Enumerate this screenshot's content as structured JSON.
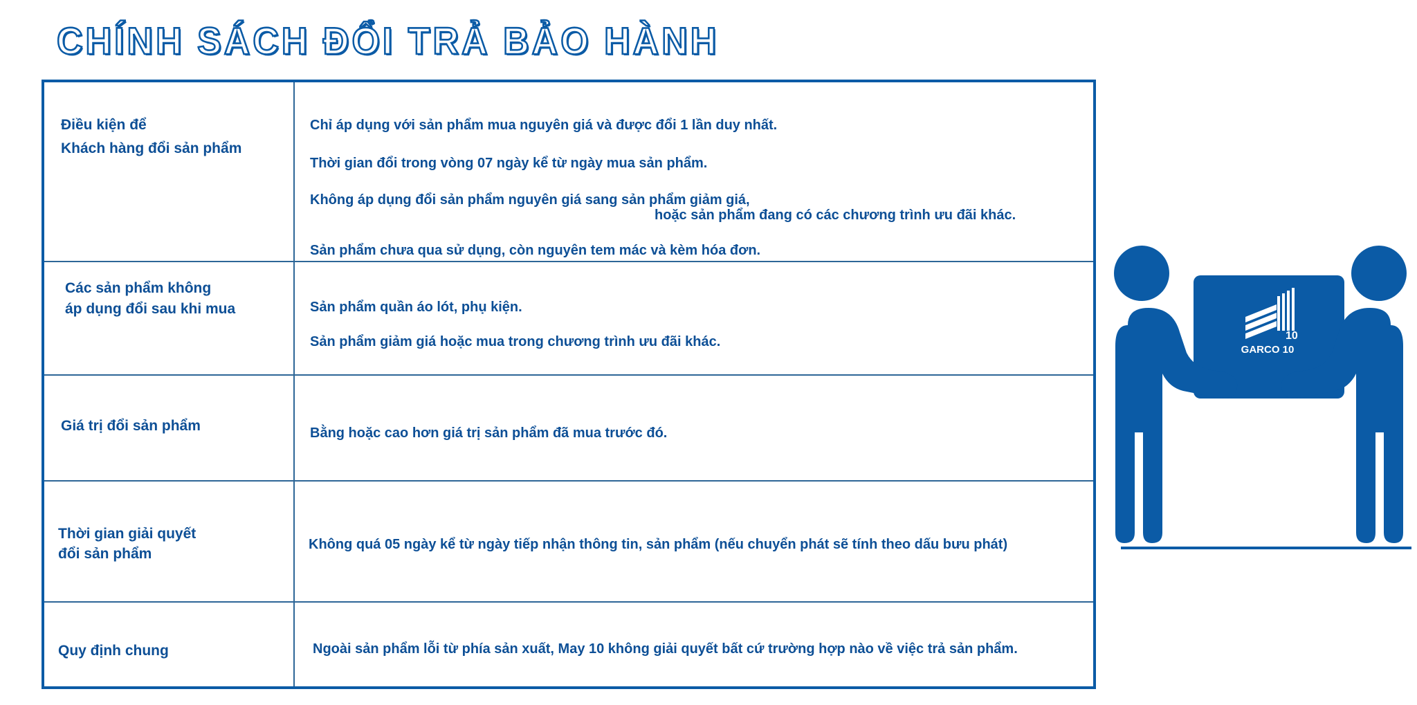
{
  "title": "CHÍNH SÁCH ĐỔI TRẢ BẢO HÀNH",
  "rows": [
    {
      "label": [
        "Điều kiện để",
        "Khách hàng đổi sản phẩm"
      ],
      "content": [
        "Chỉ áp dụng với sản phẩm mua nguyên giá và được đổi 1 lần duy nhất.",
        "Thời gian đổi trong vòng 07 ngày kể từ ngày mua sản phẩm.",
        "Không áp dụng đổi sản phẩm nguyên giá sang sản phẩm giảm giá,",
        "hoặc sản phẩm đang có các chương trình ưu đãi khác.",
        "Sản phẩm chưa qua sử dụng, còn nguyên tem mác và kèm hóa đơn."
      ]
    },
    {
      "label": [
        "Các sản phẩm không",
        "áp dụng đổi sau khi mua"
      ],
      "content": [
        "Sản phẩm quần áo lót, phụ kiện.",
        "Sản phẩm giảm giá hoặc mua trong chương trình ưu đãi khác."
      ]
    },
    {
      "label": [
        "Giá trị đổi sản phẩm"
      ],
      "content": [
        "Bằng hoặc cao hơn giá trị sản phẩm đã mua trước đó."
      ]
    },
    {
      "label": [
        "Thời gian giải quyết",
        "đổi sản phẩm"
      ],
      "content": [
        "Không quá 05 ngày kể từ ngày tiếp nhận thông tin, sản phẩm (nếu chuyển phát sẽ tính theo dấu bưu phát)"
      ]
    },
    {
      "label": [
        "Quy định chung"
      ],
      "content": [
        "Ngoài sản phẩm lỗi từ phía sản xuất, May 10 không giải quyết bất cứ trường hợp nào về việc trả sản phẩm."
      ]
    }
  ],
  "illustration": {
    "logo_text": "GARCO 10",
    "logo_number": "10"
  },
  "colors": {
    "brand": "#0b5ba6",
    "text": "#0d4f96"
  }
}
